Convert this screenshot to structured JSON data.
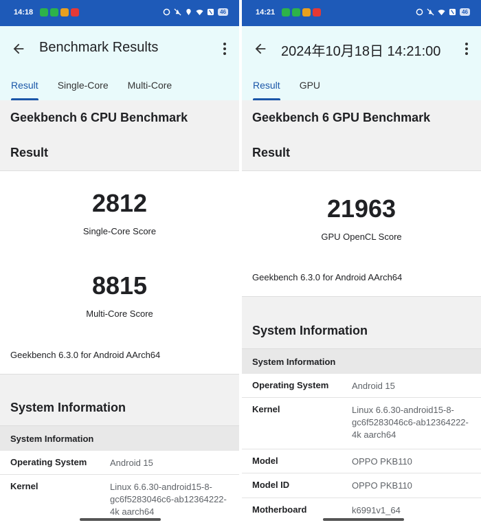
{
  "left": {
    "status": {
      "time": "14:18",
      "battery": "46"
    },
    "app_bar": {
      "title": "Benchmark Results"
    },
    "tabs": [
      {
        "label": "Result"
      },
      {
        "label": "Single-Core"
      },
      {
        "label": "Multi-Core"
      }
    ],
    "benchmark_title": "Geekbench 6 CPU Benchmark",
    "result_heading": "Result",
    "scores": [
      {
        "value": "2812",
        "label": "Single-Core Score"
      },
      {
        "value": "8815",
        "label": "Multi-Core Score"
      }
    ],
    "version": "Geekbench 6.3.0 for Android AArch64",
    "system_info_title": "System Information",
    "system_info_header": "System Information",
    "rows": [
      {
        "key": "Operating System",
        "value": "Android 15"
      },
      {
        "key": "Kernel",
        "value": "Linux 6.6.30-android15-8-gc6f5283046c6-ab12364222-4k aarch64"
      }
    ]
  },
  "right": {
    "status": {
      "time": "14:21",
      "battery": "46"
    },
    "app_bar": {
      "title": "2024年10月18日 14:21:00"
    },
    "tabs": [
      {
        "label": "Result"
      },
      {
        "label": "GPU"
      }
    ],
    "benchmark_title": "Geekbench 6 GPU Benchmark",
    "result_heading": "Result",
    "scores": [
      {
        "value": "21963",
        "label": "GPU OpenCL Score"
      }
    ],
    "version": "Geekbench 6.3.0 for Android AArch64",
    "system_info_title": "System Information",
    "system_info_header": "System Information",
    "rows": [
      {
        "key": "Operating System",
        "value": "Android 15"
      },
      {
        "key": "Kernel",
        "value": "Linux 6.6.30-android15-8-gc6f5283046c6-ab12364222-4k aarch64"
      },
      {
        "key": "Model",
        "value": "OPPO PKB110"
      },
      {
        "key": "Model ID",
        "value": "OPPO PKB110"
      },
      {
        "key": "Motherboard",
        "value": "k6991v1_64"
      }
    ]
  },
  "colors": {
    "status_bar": "#1e5ab8",
    "app_bar": "#e9fafb",
    "accent": "#1a56a8"
  },
  "icons": [
    "back-arrow-icon",
    "more-vert-icon",
    "wifi-icon",
    "location-icon",
    "alarm-off-icon",
    "nfc-icon",
    "battery-icon"
  ]
}
